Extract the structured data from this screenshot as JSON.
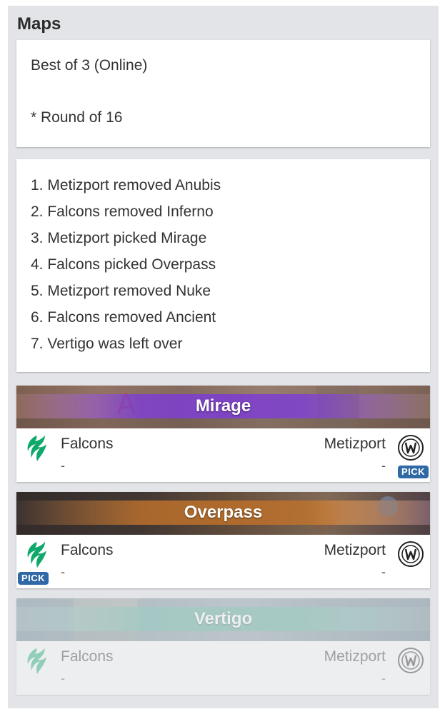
{
  "panel": {
    "title": "Maps"
  },
  "info": {
    "format": "Best of 3 (Online)",
    "stage": "* Round of 16"
  },
  "veto": [
    "1. Metizport removed Anubis",
    "2. Falcons removed Inferno",
    "3. Metizport picked Mirage",
    "4. Falcons picked Overpass",
    "5. Metizport removed Nuke",
    "6. Falcons removed Ancient",
    "7. Vertigo was left over"
  ],
  "maps": [
    {
      "name": "Mirage",
      "team_left": "Falcons",
      "team_right": "Metizport",
      "score_left": "-",
      "score_right": "-",
      "pick": "right",
      "pick_label": "PICK",
      "stripe_color": "#7b3fc7",
      "left_logo_icon": "falcons-logo-icon",
      "right_logo_icon": "metizport-logo-icon"
    },
    {
      "name": "Overpass",
      "team_left": "Falcons",
      "team_right": "Metizport",
      "score_left": "-",
      "score_right": "-",
      "pick": "left",
      "pick_label": "PICK",
      "stripe_color": "#b06a2a",
      "left_logo_icon": "falcons-logo-icon",
      "right_logo_icon": "metizport-logo-icon"
    },
    {
      "name": "Vertigo",
      "team_left": "Falcons",
      "team_right": "Metizport",
      "score_left": "-",
      "score_right": "-",
      "pick": "none",
      "stripe_color": "#3f9c86",
      "faded": true,
      "left_logo_icon": "falcons-logo-icon",
      "right_logo_icon": "metizport-logo-icon"
    }
  ],
  "colors": {
    "panel_bg": "#e3e4e8",
    "pick_badge": "#2f6aa6",
    "falcons_green": "#0fa86b"
  }
}
